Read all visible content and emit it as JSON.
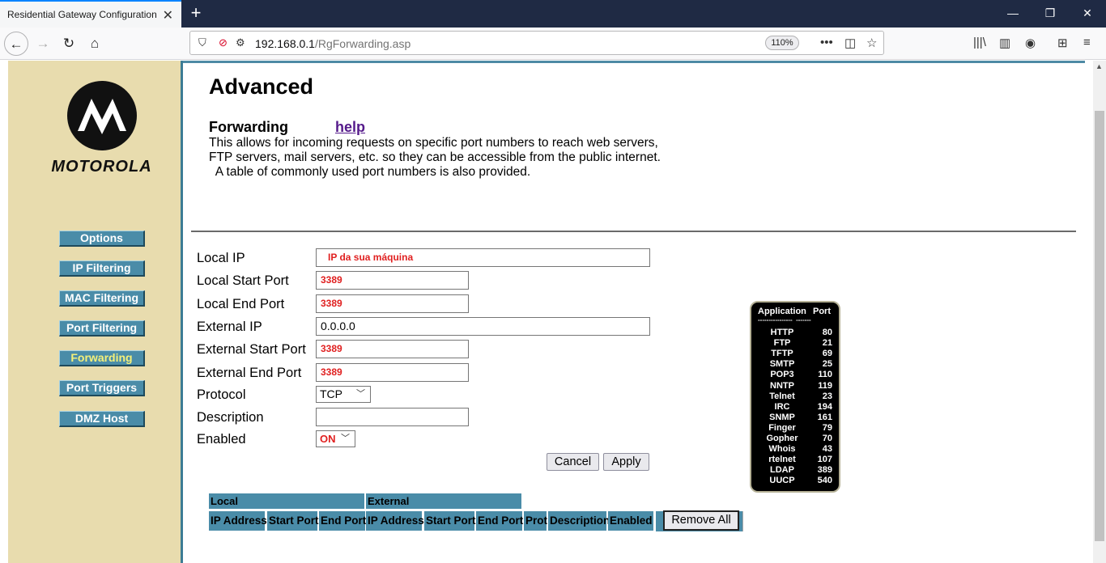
{
  "browser": {
    "tab_title": "Residential Gateway Configuration:",
    "tab_close": "✕",
    "new_tab": "+",
    "url_host": "192.168.0.1",
    "url_path": "/RgForwarding.asp",
    "zoom": "110%",
    "window_controls": [
      "—",
      "❐",
      "✕"
    ]
  },
  "sidebar": {
    "brand": "MOTOROLA",
    "items": [
      {
        "label": "Options",
        "active": false
      },
      {
        "label": "IP Filtering",
        "active": false
      },
      {
        "label": "MAC Filtering",
        "active": false
      },
      {
        "label": "Port Filtering",
        "active": false
      },
      {
        "label": "Forwarding",
        "active": true
      },
      {
        "label": "Port Triggers",
        "active": false
      },
      {
        "label": "DMZ Host",
        "active": false
      }
    ]
  },
  "main": {
    "title": "Advanced",
    "subtitle": "Forwarding",
    "help": "help",
    "description": [
      "This allows for incoming requests on specific port numbers to reach  web servers,",
      "FTP servers, mail servers, etc. so they can be accessible from the public internet.",
      "  A table of commonly used port numbers is also provided."
    ]
  },
  "form": {
    "local_ip": {
      "label": "Local IP",
      "value": "IP da sua máquina"
    },
    "local_start_port": {
      "label": "Local Start Port",
      "value": "3389"
    },
    "local_end_port": {
      "label": "Local End Port",
      "value": "3389"
    },
    "external_ip": {
      "label": "External IP",
      "value": "0.0.0.0"
    },
    "external_start_port": {
      "label": "External Start Port",
      "value": "3389"
    },
    "external_end_port": {
      "label": "External End Port",
      "value": "3389"
    },
    "protocol": {
      "label": "Protocol",
      "value": "TCP"
    },
    "description": {
      "label": "Description",
      "value": ""
    },
    "enabled": {
      "label": "Enabled",
      "value": "ON"
    },
    "cancel": "Cancel",
    "apply": "Apply"
  },
  "port_table": {
    "header_app": "Application",
    "header_port": "Port",
    "separator": "----------------  -------",
    "rows": [
      {
        "app": "HTTP",
        "port": "80"
      },
      {
        "app": "FTP",
        "port": "21"
      },
      {
        "app": "TFTP",
        "port": "69"
      },
      {
        "app": "SMTP",
        "port": "25"
      },
      {
        "app": "POP3",
        "port": "110"
      },
      {
        "app": "NNTP",
        "port": "119"
      },
      {
        "app": "Telnet",
        "port": "23"
      },
      {
        "app": "IRC",
        "port": "194"
      },
      {
        "app": "SNMP",
        "port": "161"
      },
      {
        "app": "Finger",
        "port": "79"
      },
      {
        "app": "Gopher",
        "port": "70"
      },
      {
        "app": "Whois",
        "port": "43"
      },
      {
        "app": "rtelnet",
        "port": "107"
      },
      {
        "app": "LDAP",
        "port": "389"
      },
      {
        "app": "UUCP",
        "port": "540"
      }
    ]
  },
  "rules_table": {
    "group_local": "Local",
    "group_external": "External",
    "columns": [
      "IP Address",
      "Start Port",
      "End Port",
      "IP Address",
      "Start Port",
      "End Port",
      "Prot",
      "Description",
      "Enabled"
    ],
    "remove_all": "Remove All"
  },
  "colors": {
    "sidebar_bg": "#e8dcae",
    "accent": "#4a8ca8",
    "input_red": "#e02020"
  }
}
